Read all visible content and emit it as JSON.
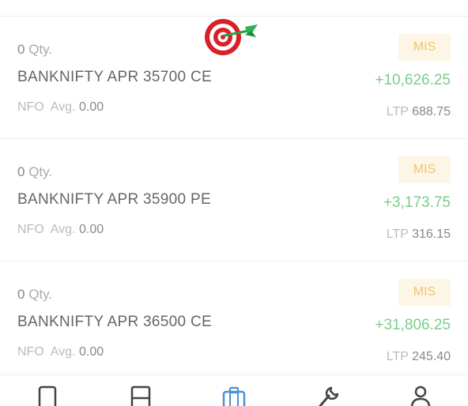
{
  "positions": [
    {
      "qty": "0",
      "qty_unit": "Qty.",
      "symbol": "BANKNIFTY APR 35700 CE",
      "exchange": "NFO",
      "avg_label": "Avg.",
      "avg": "0.00",
      "product": "MIS",
      "pnl": "+10,626.25",
      "ltp_label": "LTP",
      "ltp": "688.75"
    },
    {
      "qty": "0",
      "qty_unit": "Qty.",
      "symbol": "BANKNIFTY APR 35900 PE",
      "exchange": "NFO",
      "avg_label": "Avg.",
      "avg": "0.00",
      "product": "MIS",
      "pnl": "+3,173.75",
      "ltp_label": "LTP",
      "ltp": "316.15"
    },
    {
      "qty": "0",
      "qty_unit": "Qty.",
      "symbol": "BANKNIFTY APR 36500 CE",
      "exchange": "NFO",
      "avg_label": "Avg.",
      "avg": "0.00",
      "product": "MIS",
      "pnl": "+31,806.25",
      "ltp_label": "LTP",
      "ltp": "245.40"
    }
  ],
  "colors": {
    "profit": "#7ccd8b",
    "badge_bg": "#fdf6e7",
    "badge_text": "#f0c46e",
    "nav_active": "#4a90d9",
    "nav_inactive": "#444444"
  },
  "decoration": {
    "emoji": "direct-hit-target"
  },
  "bottom_nav": {
    "items": [
      {
        "icon": "watchlist-icon",
        "active": false
      },
      {
        "icon": "orders-icon",
        "active": false
      },
      {
        "icon": "portfolio-icon",
        "active": true
      },
      {
        "icon": "tools-icon",
        "active": false
      },
      {
        "icon": "profile-icon",
        "active": false
      }
    ]
  }
}
